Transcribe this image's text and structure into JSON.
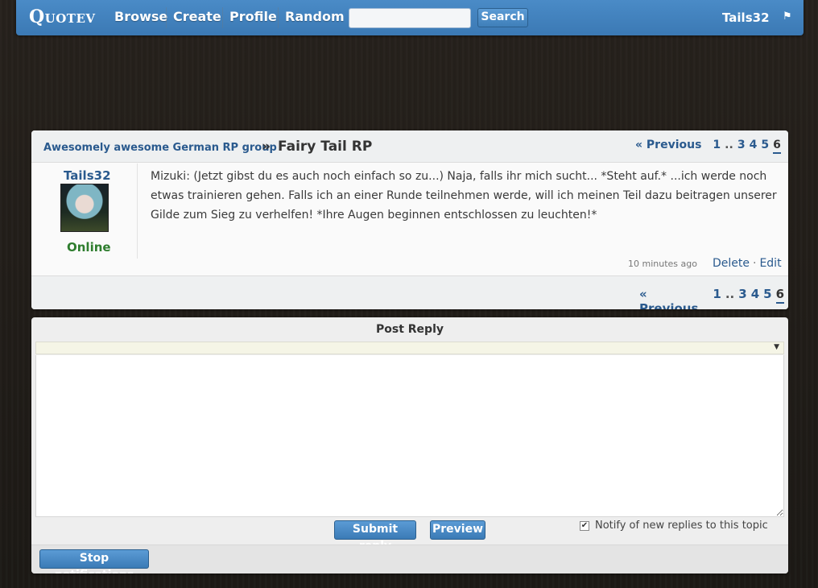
{
  "nav": {
    "logo": "Quotev",
    "links": [
      "Browse",
      "Create",
      "Profile",
      "Random"
    ],
    "search_placeholder": "",
    "search_button": "Search",
    "username": "Tails32",
    "flag_icon": "⚑"
  },
  "topic": {
    "group": "Awesomely awesome German RP group",
    "separator": "»",
    "title": "Fairy Tail RP"
  },
  "pagination": {
    "prev": "« Previous",
    "first": "1",
    "dots": "..",
    "pages": [
      "3",
      "4",
      "5",
      "6"
    ],
    "current": "6"
  },
  "post": {
    "author": "Tails32",
    "status": "Online",
    "body": "Mizuki: (Jetzt gibst du es auch noch einfach so zu...) Naja, falls ihr mich sucht... *Steht auf.* ...ich werde noch etwas trainieren gehen. Falls ich an einer Runde teilnehmen werde, will ich meinen Teil dazu beitragen unserer Gilde zum Sieg zu verhelfen! *Ihre Augen beginnen entschlossen zu leuchten!*",
    "time": "10 minutes ago",
    "delete": "Delete",
    "action_sep": "·",
    "edit": "Edit"
  },
  "reply": {
    "title": "Post Reply",
    "submit": "Submit reply",
    "preview": "Preview",
    "notify_label": "Notify of new replies to this topic",
    "notify_checked": true,
    "stop_notifications": "Stop notifications"
  },
  "colors": {
    "nav_bg": "#3b79b4",
    "link": "#2a5a8e",
    "online": "#2e7d2e",
    "page_bg": "#1f1b17"
  }
}
